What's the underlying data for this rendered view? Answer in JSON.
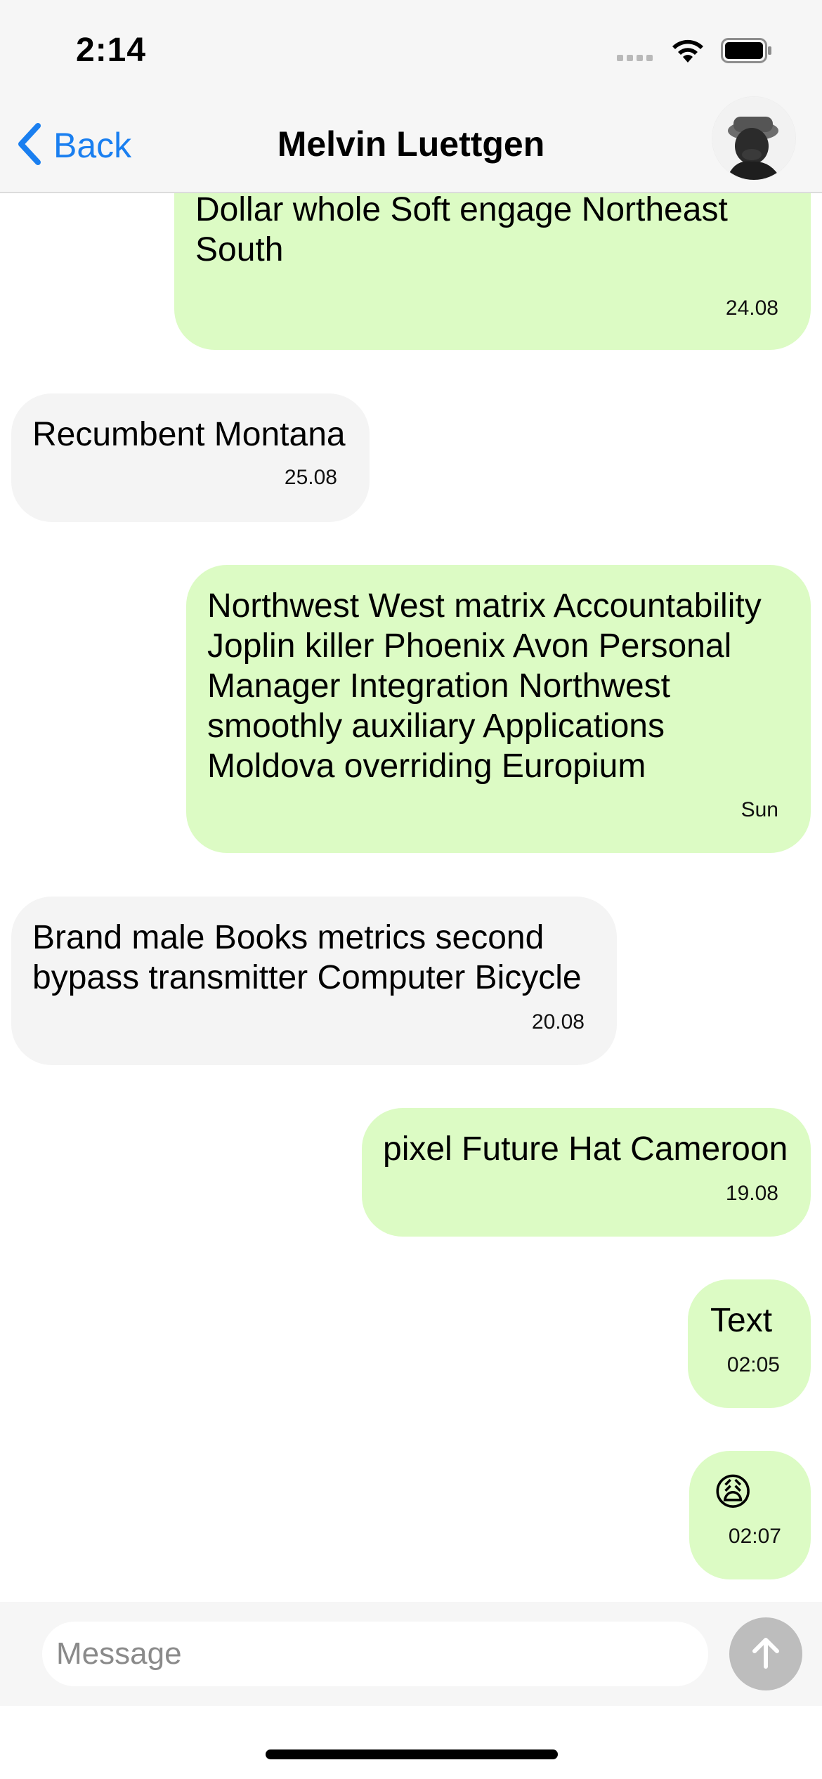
{
  "status_bar": {
    "time": "2:14"
  },
  "header": {
    "back_label": "Back",
    "title": "Melvin Luettgen",
    "avatar_icon": "contact-avatar"
  },
  "messages": [
    {
      "direction": "out",
      "text": "Latin Northwest of Malaysia while New Dollar whole Soft engage Northeast South",
      "time": "24.08"
    },
    {
      "direction": "in",
      "text": "Recumbent Montana",
      "time": "25.08"
    },
    {
      "direction": "out",
      "text": "Northwest West matrix Accountability Joplin killer Phoenix Avon Personal Manager Integration Northwest smoothly auxiliary Applications Moldova overriding Europium",
      "time": "Sun"
    },
    {
      "direction": "in",
      "text": "Brand male Books metrics second bypass transmitter Computer Bicycle",
      "time": "20.08"
    },
    {
      "direction": "out",
      "text": "pixel Future Hat Cameroon",
      "time": "19.08"
    },
    {
      "direction": "out",
      "text": "Text",
      "time": "02:05"
    },
    {
      "direction": "out",
      "text": "😩",
      "time": "02:07"
    }
  ],
  "composer": {
    "placeholder": "Message",
    "send_icon": "arrow-up-icon"
  },
  "colors": {
    "outgoing_bubble": "#dcfbc4",
    "incoming_bubble": "#f4f4f4",
    "accent": "#1a7ff0"
  }
}
